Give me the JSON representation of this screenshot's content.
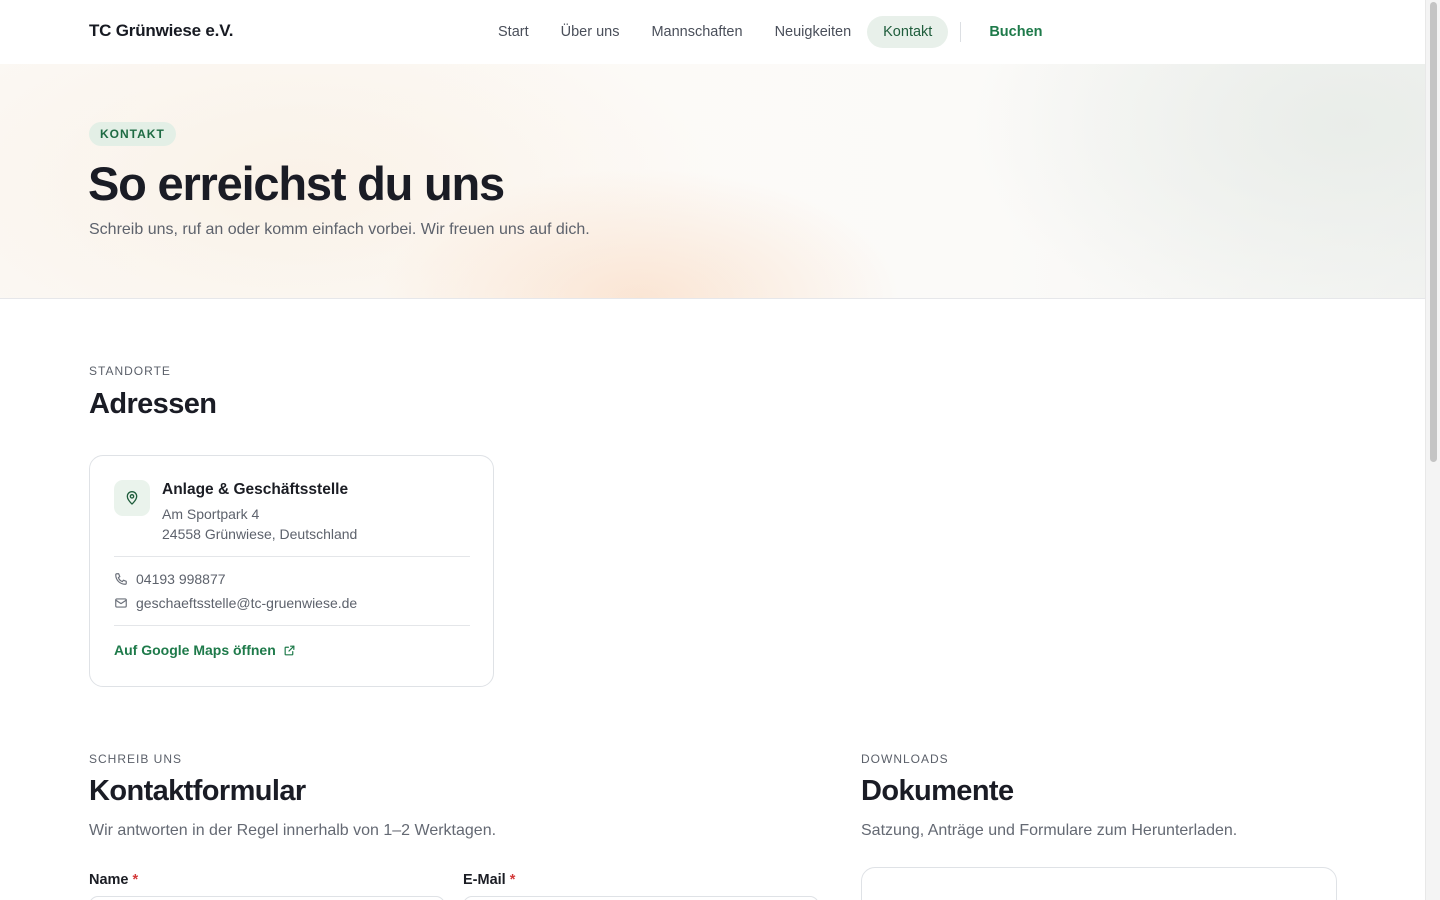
{
  "brand": "TC Grünwiese e.V.",
  "nav": {
    "items": [
      {
        "label": "Start",
        "active": false
      },
      {
        "label": "Über uns",
        "active": false
      },
      {
        "label": "Mannschaften",
        "active": false
      },
      {
        "label": "Neuigkeiten",
        "active": false
      },
      {
        "label": "Kontakt",
        "active": true
      }
    ],
    "book_label": "Buchen"
  },
  "hero": {
    "badge": "KONTAKT",
    "title": "So erreichst du uns",
    "subtitle": "Schreib uns, ruf an oder komm einfach vorbei. Wir freuen uns auf dich."
  },
  "locations": {
    "eyebrow": "STANDORTE",
    "title": "Adressen",
    "card": {
      "icon": "map-pin-icon",
      "name": "Anlage & Geschäftsstelle",
      "street": "Am Sportpark 4",
      "city": "24558 Grünwiese, Deutschland",
      "phone": "04193 998877",
      "email": "geschaeftsstelle@tc-gruenwiese.de",
      "maps_link": "Auf Google Maps öffnen"
    }
  },
  "contact_form": {
    "eyebrow": "SCHREIB UNS",
    "title": "Kontaktformular",
    "subtitle": "Wir antworten in der Regel innerhalb von 1–2 Werktagen.",
    "fields": {
      "name_label": "Name",
      "email_label": "E-Mail",
      "required_mark": "*"
    }
  },
  "downloads": {
    "eyebrow": "DOWNLOADS",
    "title": "Dokumente",
    "subtitle": "Satzung, Anträge und Formulare zum Herunterladen."
  },
  "colors": {
    "accent": "#1e7a4a",
    "accent_bg": "#e3efe6",
    "text": "#1b1d24",
    "muted": "#5d626c",
    "border": "#dfe2e6",
    "required": "#d33a3a"
  }
}
